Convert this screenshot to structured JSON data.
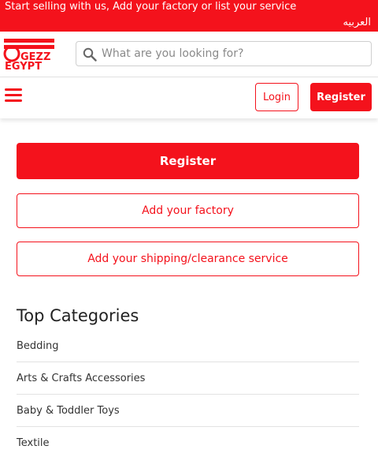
{
  "topbar": {
    "promo_text": "Start selling with us, Add your factory or list your service",
    "language_link": "العربيه"
  },
  "header": {
    "logo_text_top": "GEZZ",
    "logo_text_bottom": "EGYPT",
    "search_placeholder": "What are you looking for?"
  },
  "nav": {
    "login_label": "Login",
    "register_label": "Register"
  },
  "main": {
    "register_label": "Register",
    "add_factory_label": "Add your factory",
    "add_service_label": "Add your shipping/clearance service"
  },
  "categories": {
    "title": "Top Categories",
    "items": [
      "Bedding",
      "Arts & Crafts Accessories",
      "Baby & Toddler Toys",
      "Textile"
    ]
  },
  "colors": {
    "brand_red": "#f4121c"
  },
  "icons": {
    "search": "search-icon",
    "menu": "hamburger-menu-icon"
  }
}
